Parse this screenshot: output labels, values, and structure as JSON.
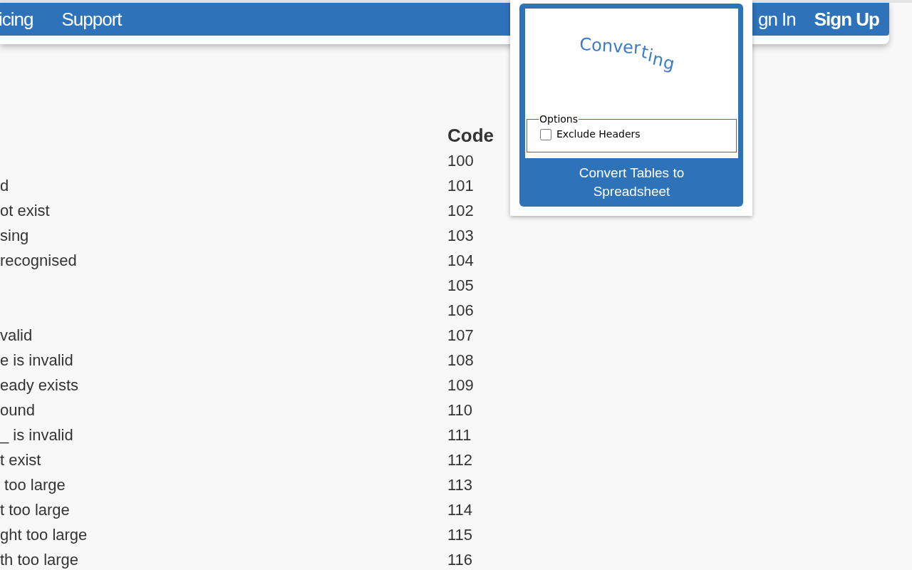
{
  "nav": {
    "items": [
      {
        "label": "icing",
        "bold": false
      },
      {
        "label": "Support",
        "bold": false
      }
    ],
    "right_items": [
      {
        "label": "gn In",
        "bold": false
      },
      {
        "label": "Sign Up",
        "bold": true
      }
    ]
  },
  "table": {
    "columns": [
      "Code"
    ],
    "rows": [
      {
        "code": "100"
      },
      {
        "description": "d",
        "code": "101"
      },
      {
        "description": "ot exist",
        "code": "102"
      },
      {
        "description": "sing",
        "code": "103"
      },
      {
        "description": "recognised",
        "code": "104"
      },
      {
        "code": "105"
      },
      {
        "code": "106"
      },
      {
        "description": "valid",
        "code": "107"
      },
      {
        "description": "e is invalid",
        "code": "108"
      },
      {
        "description": "eady exists",
        "code": "109"
      },
      {
        "description": "ound",
        "code": "110"
      },
      {
        "description": "_ is invalid",
        "code": "111"
      },
      {
        "description": "t exist",
        "code": "112"
      },
      {
        "description": " too large",
        "code": "113"
      },
      {
        "description": "t too large",
        "code": "114"
      },
      {
        "description": "ght too large",
        "code": "115"
      },
      {
        "description": "th too large",
        "code": "116"
      }
    ]
  },
  "popup": {
    "status": "Converting",
    "options_legend": "Options",
    "options": [
      {
        "label": "Exclude Headers",
        "checked": false
      }
    ],
    "button": "Convert Tables to Spreadsheet"
  }
}
